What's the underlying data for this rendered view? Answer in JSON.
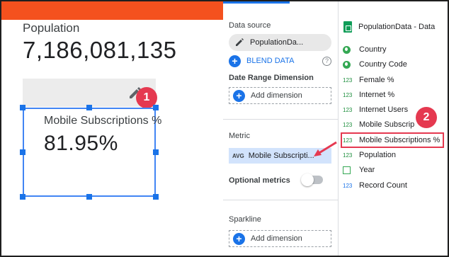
{
  "canvas": {
    "scorecard1": {
      "label": "Population",
      "value": "7,186,081,135"
    },
    "scorecard2": {
      "label": "Mobile Subscriptions %",
      "value": "81.95%"
    },
    "badge1": "1"
  },
  "properties": {
    "data_source_title": "Data source",
    "data_source_name": "PopulationDa...",
    "blend_label": "BLEND DATA",
    "help_glyph": "?",
    "date_range_title": "Date Range Dimension",
    "add_dimension_label": "Add dimension",
    "metric_title": "Metric",
    "metric_agg": "AVG",
    "metric_field": "Mobile Subscripti...",
    "optional_metrics_label": "Optional metrics",
    "sparkline_title": "Sparkline",
    "sparkline_add_dimension": "Add dimension"
  },
  "data_panel": {
    "source_name": "PopulationData - Data",
    "fields": [
      {
        "icon": "globe-icon",
        "type": "",
        "label": "Country"
      },
      {
        "icon": "globe-icon",
        "type": "",
        "label": "Country Code"
      },
      {
        "icon": "number-icon",
        "type": "123",
        "label": "Female %"
      },
      {
        "icon": "number-icon",
        "type": "123",
        "label": "Internet %"
      },
      {
        "icon": "number-icon",
        "type": "123",
        "label": "Internet Users"
      },
      {
        "icon": "number-icon",
        "type": "123",
        "label": "Mobile Subscrip"
      },
      {
        "icon": "number-icon",
        "type": "123",
        "label": "Mobile Subscriptions %"
      },
      {
        "icon": "number-icon",
        "type": "123",
        "label": "Population"
      },
      {
        "icon": "calendar-icon",
        "type": "",
        "label": "Year"
      },
      {
        "icon": "number-icon",
        "type": "123",
        "label": "Record Count"
      }
    ],
    "badge2": "2"
  },
  "colors": {
    "accent": "#f4511e",
    "selection": "#1a73e8",
    "annotation": "#e53950",
    "metric_chip": "#d2e3fc"
  }
}
